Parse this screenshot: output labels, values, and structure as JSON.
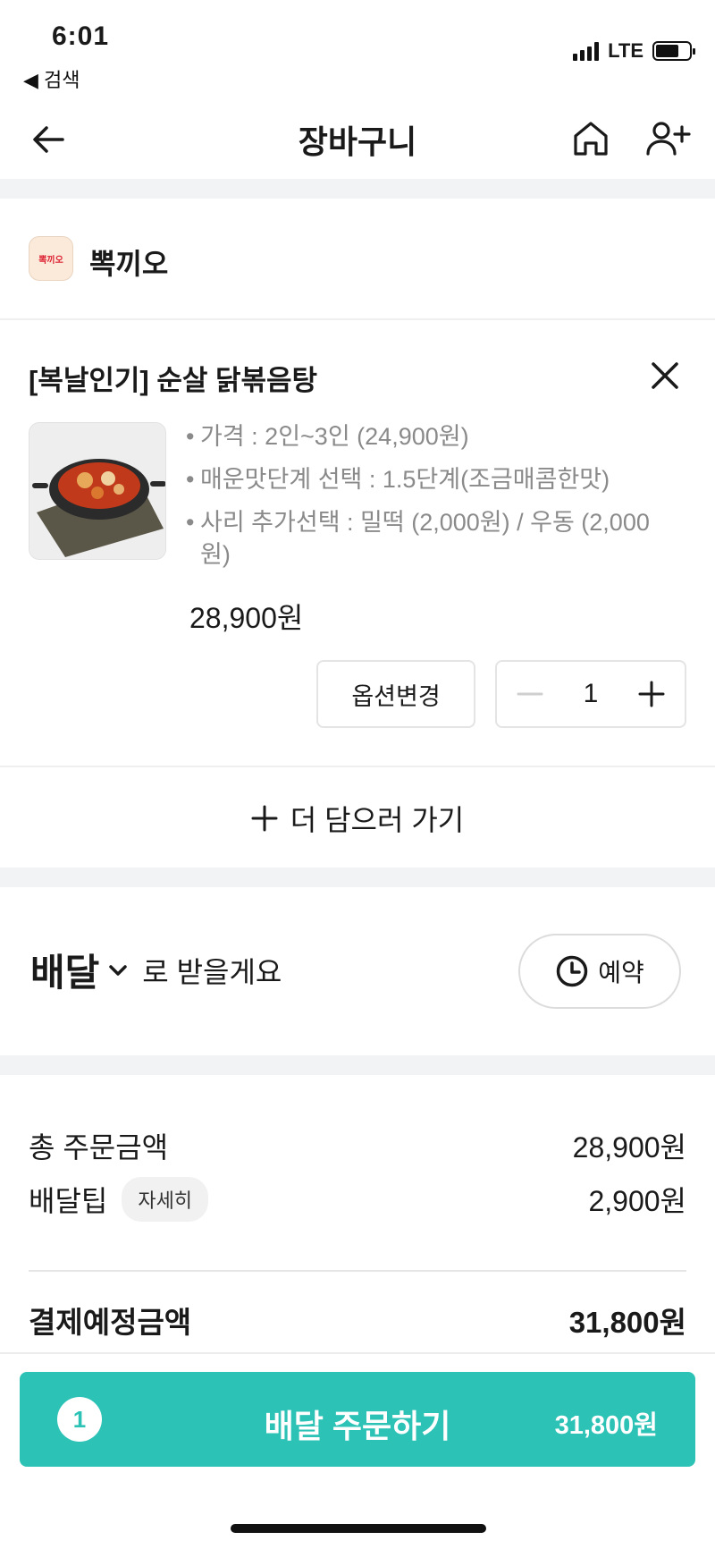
{
  "status_bar": {
    "time": "6:01",
    "back_app": "◀ 검색",
    "network": "LTE"
  },
  "header": {
    "title": "장바구니"
  },
  "store": {
    "name": "뽁끼오",
    "logo_text": "뽁끼오"
  },
  "cart_item": {
    "title": "[복날인기] 순살 닭볶음탕",
    "options": [
      "가격 : 2인~3인 (24,900원)",
      "매운맛단계 선택 : 1.5단계(조금매콤한맛)",
      "사리 추가선택 : 밀떡 (2,000원) / 우동 (2,000원)"
    ],
    "price": "28,900원",
    "option_change_label": "옵션변경",
    "quantity": "1"
  },
  "add_more": {
    "label": "더 담으러 가기"
  },
  "delivery": {
    "mode": "배달",
    "suffix": "로 받을게요",
    "reserve_label": "예약"
  },
  "summary": {
    "total_order_label": "총 주문금액",
    "total_order_value": "28,900원",
    "delivery_tip_label": "배달팁",
    "delivery_tip_detail": "자세히",
    "delivery_tip_value": "2,900원",
    "payment_label": "결제예정금액",
    "payment_value": "31,800원"
  },
  "order_button": {
    "count": "1",
    "label": "배달 주문하기",
    "total": "31,800원"
  },
  "colors": {
    "accent": "#2cc2b6",
    "separator": "#f2f3f5"
  }
}
